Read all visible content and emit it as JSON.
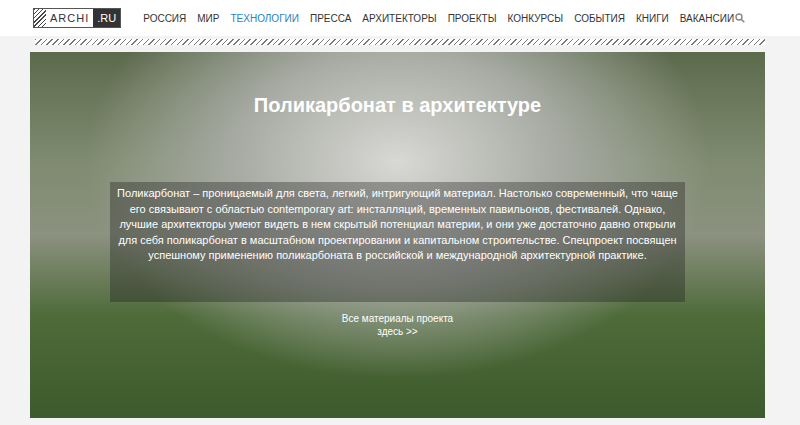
{
  "logo": {
    "text": "ARCHI",
    "suffix": ".RU"
  },
  "nav": [
    {
      "label": "РОССИЯ",
      "selected": false
    },
    {
      "label": "МИР",
      "selected": false
    },
    {
      "label": "ТЕХНОЛОГИИ",
      "selected": true
    },
    {
      "label": "ПРЕССА",
      "selected": false
    },
    {
      "label": "АРХИТЕКТОРЫ",
      "selected": false
    },
    {
      "label": "ПРОЕКТЫ",
      "selected": false
    },
    {
      "label": "КОНКУРСЫ",
      "selected": false
    },
    {
      "label": "СОБЫТИЯ",
      "selected": false
    },
    {
      "label": "КНИГИ",
      "selected": false
    },
    {
      "label": "ВАКАНСИИ",
      "selected": false
    }
  ],
  "hero": {
    "title": "Поликарбонат в архитектуре",
    "description": "Поликарбонат – проницаемый для света, легкий, интригующий материал. Настолько современный, что чаще его связывают с областью contemporary art: инсталляций, временных павильонов, фестивалей. Однако, лучшие архитекторы умеют видеть в нем скрытый потенциал материи, и они уже достаточно давно открыли для себя поликарбонат в масштабном проектировании и капитальном строительстве. Спецпроект посвящен успешному применению поликарбоната в российской и международной архитектурной практике.",
    "link": "Все материалы проекта здесь >>"
  }
}
